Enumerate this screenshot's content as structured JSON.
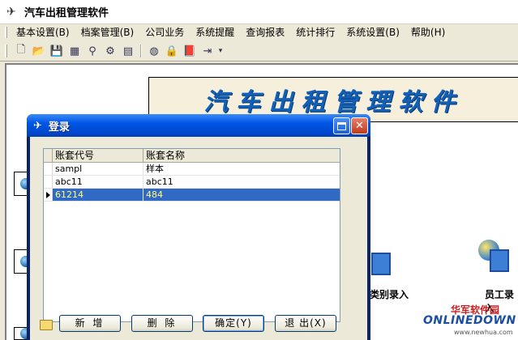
{
  "app": {
    "title": "汽车出租管理软件",
    "banner_text": "汽车出租管理软件"
  },
  "menu": [
    {
      "label": "基本设置(B)"
    },
    {
      "label": "档案管理(B)"
    },
    {
      "label": "公司业务"
    },
    {
      "label": "系统提醒"
    },
    {
      "label": "查询报表"
    },
    {
      "label": "统计排行"
    },
    {
      "label": "系统设置(B)"
    },
    {
      "label": "帮助(H)"
    }
  ],
  "toolbar": {
    "icons": [
      "new-doc-icon",
      "open-folder-icon",
      "save-icon",
      "calculator-icon",
      "search-icon",
      "tools-icon",
      "grid-icon",
      "globe-icon",
      "lock-icon",
      "book-icon",
      "exit-icon"
    ]
  },
  "background": {
    "labels": {
      "category_entry": "类别录入",
      "staff_entry": "员工录入"
    }
  },
  "watermark": {
    "cn": "华军软件园",
    "en": "ONLINEDOWN",
    "url": "www.newhua.com"
  },
  "dialog": {
    "title": "登录",
    "columns": [
      "账套代号",
      "账套名称"
    ],
    "rows": [
      {
        "code": "sampl",
        "name": "样本"
      },
      {
        "code": "abc11",
        "name": "abc11"
      },
      {
        "code": "61214",
        "name": "484"
      }
    ],
    "selected_row": 2,
    "buttons": {
      "add": "新 增",
      "delete": "删 除",
      "ok": "确定(Y)",
      "exit": "退 出(X)"
    }
  },
  "colors": {
    "titlebar": "#0055e5",
    "selection": "#316ac5",
    "banner_text": "#1260b8"
  }
}
